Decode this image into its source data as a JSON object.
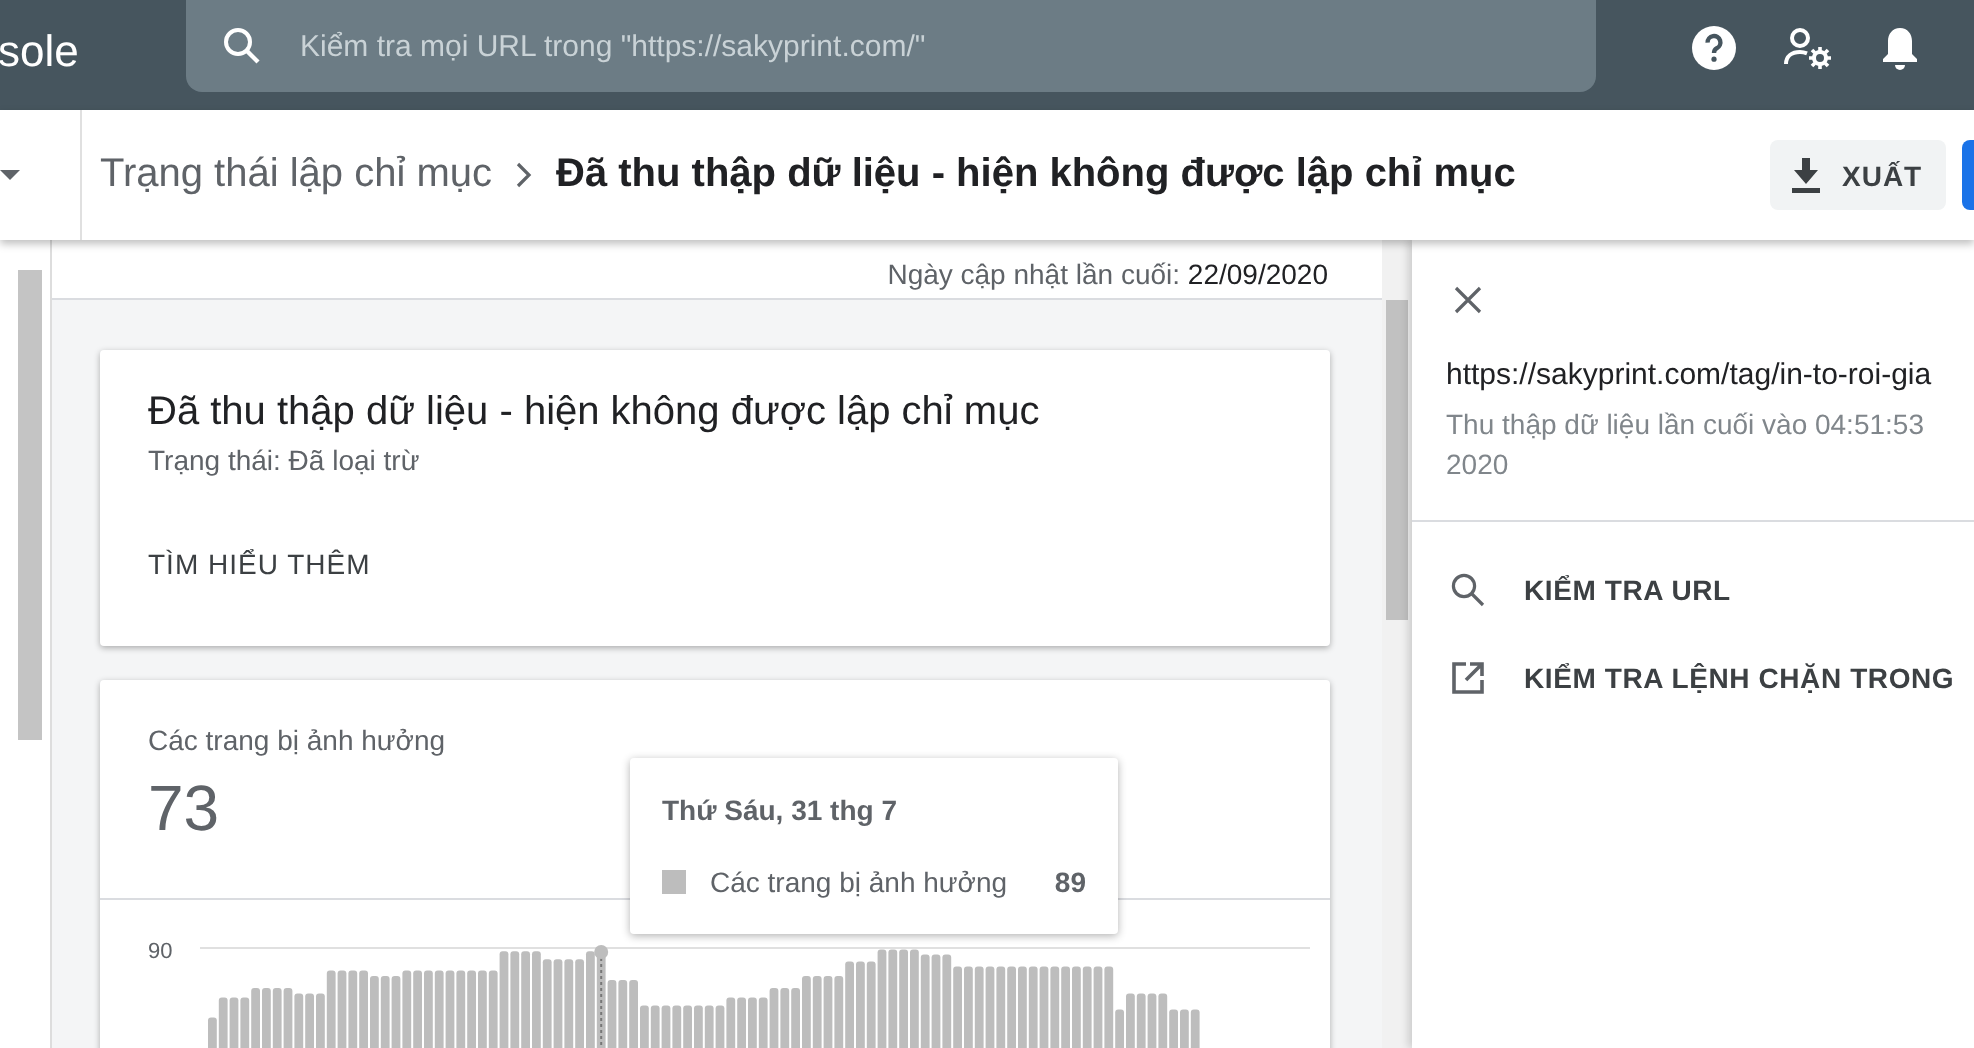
{
  "app_title": "sole",
  "search": {
    "placeholder": "Kiểm tra mọi URL trong \"https://sakyprint.com/\""
  },
  "breadcrumb": {
    "parent": "Trạng thái lập chỉ mục",
    "current": "Đã thu thập dữ liệu - hiện không được lập chỉ mục"
  },
  "export_button": "XUẤT",
  "last_updated": {
    "label": "Ngày cập nhật lần cuối:",
    "value": "22/09/2020"
  },
  "status_card": {
    "title": "Đã thu thập dữ liệu - hiện không được lập chỉ mục",
    "status": "Trạng thái: Đã loại trừ",
    "link": "TÌM HIỂU THÊM"
  },
  "affected_card": {
    "label": "Các trang bị ảnh hưởng",
    "count": "73",
    "y_tick": "90",
    "tooltip": {
      "date": "Thứ Sáu, 31 thg 7",
      "series": "Các trang bị ảnh hưởng",
      "value": "89"
    }
  },
  "detail_panel": {
    "url": "https://sakyprint.com/tag/in-to-roi-gia",
    "crawl_info": "Thu thập dữ liệu lần cuối vào 04:51:53\n2020",
    "actions": [
      {
        "kind": "search",
        "label": "KIỂM TRA URL"
      },
      {
        "kind": "external",
        "label": "KIỂM TRA LỆNH CHẶN TRONG"
      }
    ]
  }
}
